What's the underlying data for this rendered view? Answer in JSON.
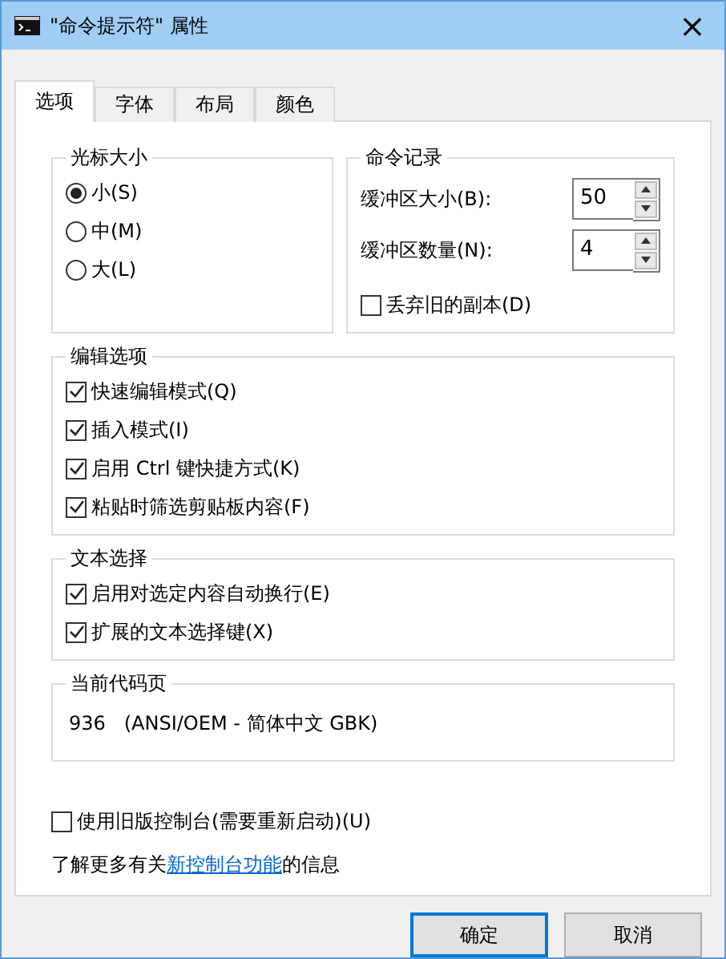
{
  "window": {
    "title": "\"命令提示符\" 属性",
    "close": "×"
  },
  "tabs": [
    {
      "label": "选项",
      "selected": true
    },
    {
      "label": "字体",
      "selected": false
    },
    {
      "label": "布局",
      "selected": false
    },
    {
      "label": "颜色",
      "selected": false
    }
  ],
  "cursor_size": {
    "title": "光标大小",
    "options": [
      {
        "label": "小(S)",
        "selected": true
      },
      {
        "label": "中(M)",
        "selected": false
      },
      {
        "label": "大(L)",
        "selected": false
      }
    ]
  },
  "command_history": {
    "title": "命令记录",
    "fields": [
      {
        "label": "缓冲区大小(B):",
        "value": "50"
      },
      {
        "label": "缓冲区数量(N):",
        "value": "4"
      }
    ],
    "discard": {
      "label": "丢弃旧的副本(D)",
      "checked": false
    }
  },
  "edit_options": {
    "title": "编辑选项",
    "items": [
      {
        "label": "快速编辑模式(Q)",
        "checked": true
      },
      {
        "label": "插入模式(I)",
        "checked": true
      },
      {
        "label": "启用 Ctrl 键快捷方式(K)",
        "checked": true
      },
      {
        "label": "粘贴时筛选剪贴板内容(F)",
        "checked": true
      }
    ]
  },
  "text_selection": {
    "title": "文本选择",
    "items": [
      {
        "label": "启用对选定内容自动换行(E)",
        "checked": true
      },
      {
        "label": "扩展的文本选择键(X)",
        "checked": true
      }
    ]
  },
  "code_page": {
    "title": "当前代码页",
    "value": "936   (ANSI/OEM - 简体中文 GBK)"
  },
  "legacy": {
    "label": "使用旧版控制台(需要重新启动)(U)",
    "checked": false
  },
  "learn_more": {
    "before": "了解更多有关",
    "link": "新控制台功能",
    "after": "的信息"
  },
  "buttons": [
    {
      "label": "确定",
      "kind": "default"
    },
    {
      "label": "取消",
      "kind": "normal"
    }
  ]
}
